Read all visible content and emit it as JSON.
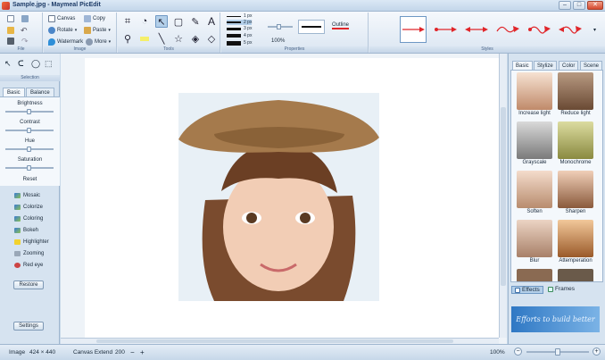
{
  "window": {
    "title": "Sample.jpg - Maymeal PicEdit"
  },
  "ribbon": {
    "file": {
      "label": "File"
    },
    "image": {
      "label": "Image",
      "canvas": "Canvas",
      "copy": "Copy",
      "rotate": "Rotate",
      "paste": "Paste",
      "watermark": "Watermark",
      "more": "More"
    },
    "tools": {
      "label": "Tools",
      "text_icon": "A"
    },
    "properties": {
      "label": "Properties",
      "line_widths": [
        "1 px",
        "2 px",
        "3 px",
        "4 px",
        "5 px"
      ],
      "zoom": "100%",
      "outline": "Outline"
    },
    "styles": {
      "label": "Styles"
    }
  },
  "left_panel": {
    "selection_label": "Selection",
    "tabs": [
      "Basic",
      "Balance"
    ],
    "adjustments": [
      "Brightness",
      "Contrast",
      "Hue",
      "Saturation"
    ],
    "reset": "Reset",
    "effects": [
      "Mosaic",
      "Colorize",
      "Coloring",
      "Bokeh",
      "Highlighter",
      "Zooming",
      "Red eye"
    ],
    "restore": "Restore",
    "settings": "Settings"
  },
  "right_panel": {
    "tabs": [
      "Basic",
      "Stylize",
      "Color",
      "Scene"
    ],
    "thumbnails": [
      "Increase light",
      "Reduce light",
      "Grayscale",
      "Monochrome",
      "Soften",
      "Sharpen",
      "Blur",
      "Attemperation"
    ],
    "bottom_tabs": [
      "Effects",
      "Frames"
    ],
    "banner": "Efforts to build better"
  },
  "status": {
    "image_label": "Image",
    "image_size": "424 × 440",
    "canvas_extend_label": "Canvas Extend",
    "canvas_extend_value": "200",
    "minus": "−",
    "plus": "+",
    "zoom": "100%"
  },
  "colors": {
    "accent": "#e0262a",
    "panel": "#d6e3f0",
    "ribbon_border": "#9fb6cf"
  }
}
